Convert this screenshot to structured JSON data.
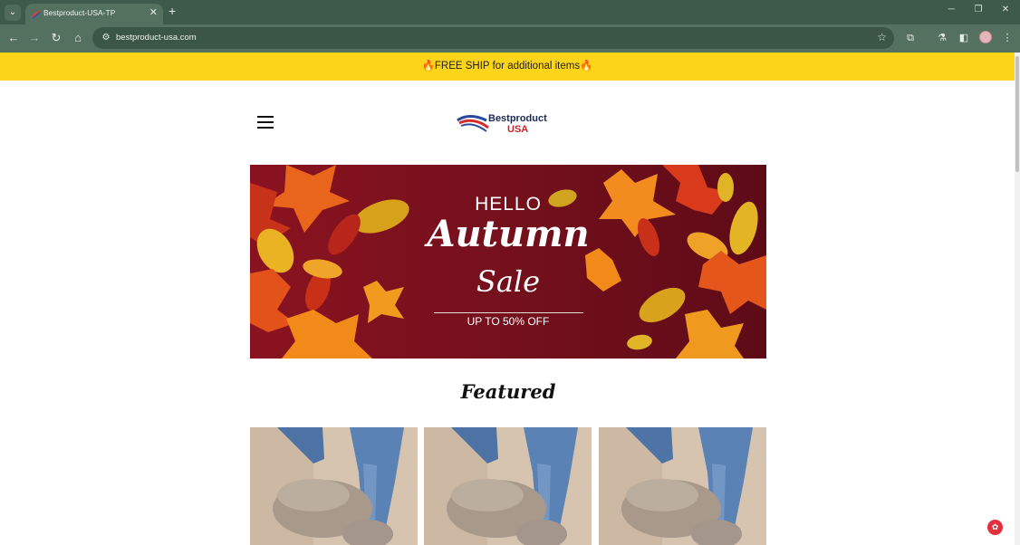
{
  "browser": {
    "tab_title": "Bestproduct-USA-TP",
    "url": "bestproduct-usa.com",
    "tab_list_icon": "chevron-down-icon",
    "close_tab_icon": "close-icon",
    "new_tab_icon": "plus-icon"
  },
  "promo": {
    "text": "🔥FREE SHIP for additional items🔥"
  },
  "header": {
    "logo_line1": "Bestproduct",
    "logo_line2": "USA"
  },
  "banner": {
    "hello": "HELLO",
    "autumn": "Autumn",
    "sale": "Sale",
    "offer": "UP TO 50% OFF"
  },
  "featured": {
    "title": "Featured"
  },
  "products": [
    {
      "image": "shoe-photo"
    },
    {
      "image": "shoe-photo"
    },
    {
      "image": "shoe-photo"
    }
  ],
  "colors": {
    "promo_bg": "#fcd51a",
    "banner_bg": "#7d0f1c",
    "chrome_bg": "#3d5a4a"
  }
}
